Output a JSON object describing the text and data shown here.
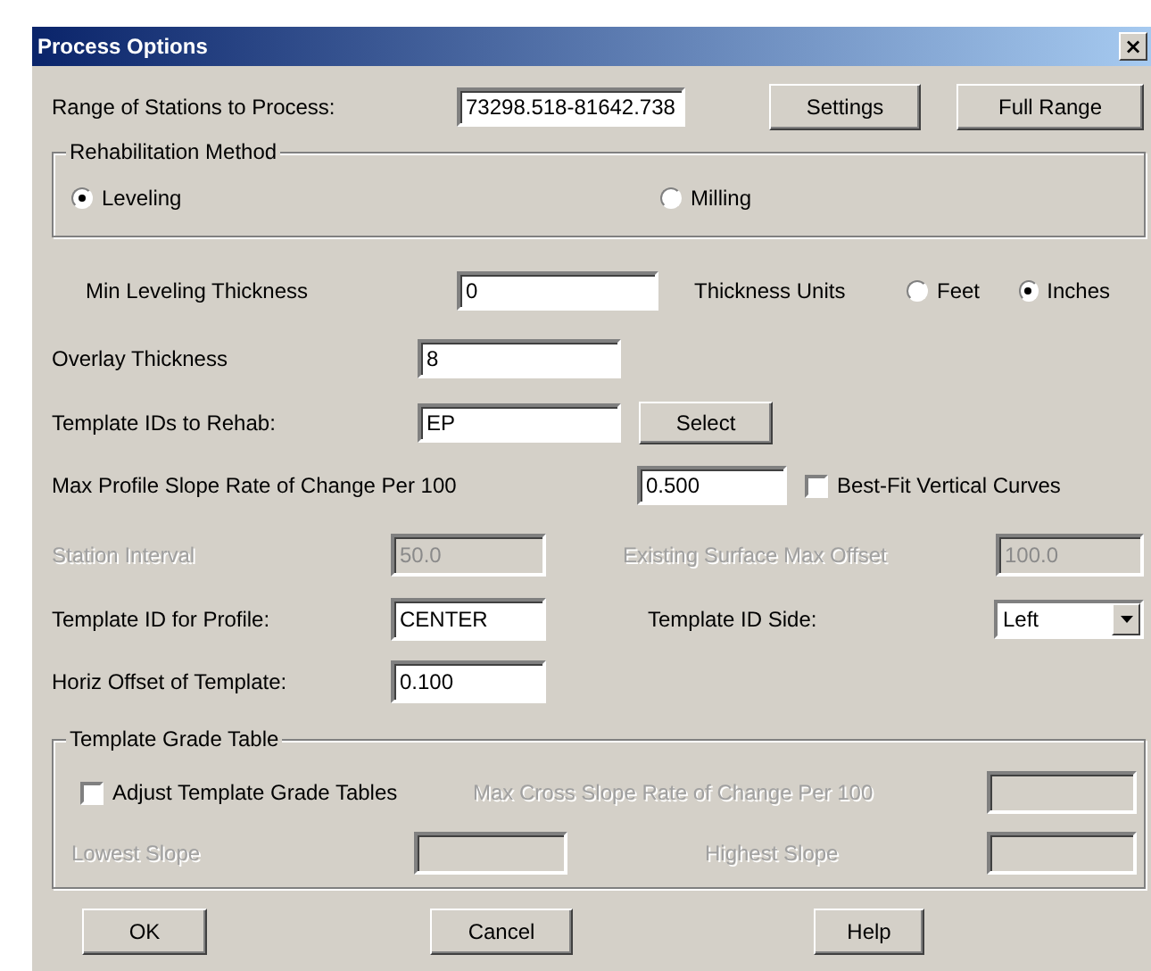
{
  "window": {
    "title": "Process Options",
    "close": "×"
  },
  "range": {
    "label": "Range of Stations to Process:",
    "value": "73298.518-81642.738",
    "buttons": [
      "Settings",
      "Full Range"
    ]
  },
  "rehabilitation_method": {
    "title": "Rehabilitation Method",
    "options": [
      {
        "label": "Leveling",
        "selected": true
      },
      {
        "label": "Milling",
        "selected": false
      }
    ]
  },
  "min_leveling_thickness": {
    "label": "Min Leveling Thickness",
    "value": "0",
    "disabled": false
  },
  "thickness_units": {
    "label": "Thickness Units",
    "options": [
      {
        "label": "Feet",
        "selected": false
      },
      {
        "label": "Inches",
        "selected": true
      }
    ]
  },
  "overlay_thickness": {
    "label": "Overlay Thickness",
    "value": "8",
    "disabled": false
  },
  "template_ids": {
    "label": "Template IDs to Rehab:",
    "value": "EP",
    "disabled": false,
    "button": "Select"
  },
  "max_profile_slope": {
    "label": "Max Profile Slope Rate of Change Per 100",
    "value": "0.500",
    "disabled": false
  },
  "best_fit": {
    "label": "Best-Fit Vertical Curves",
    "checked": false
  },
  "station_interval": {
    "label": "Station Interval",
    "value": "50.0",
    "disabled": true
  },
  "existing_surface_max_offset": {
    "label": "Existing Surface Max Offset",
    "value": "100.0",
    "disabled": true
  },
  "template_id_for_profile": {
    "label": "Template ID for Profile:",
    "value": "CENTER",
    "disabled": false
  },
  "template_id_side": {
    "label": "Template ID Side:",
    "value": "Left"
  },
  "horiz_offset": {
    "label": "Horiz Offset of Template:",
    "value": "0.100",
    "disabled": false
  },
  "template_grade_table": {
    "title": "Template Grade Table",
    "adjust": {
      "label": "Adjust Template Grade Tables",
      "checked": false
    },
    "max_cross_slope": {
      "label": "Max Cross Slope Rate of Change Per 100",
      "disabled": true
    },
    "lowest_slope": {
      "label": "Lowest Slope",
      "disabled": true
    },
    "highest_slope": {
      "label": "Highest Slope",
      "disabled": true
    }
  },
  "buttons": [
    "OK",
    "Cancel",
    "Help"
  ]
}
